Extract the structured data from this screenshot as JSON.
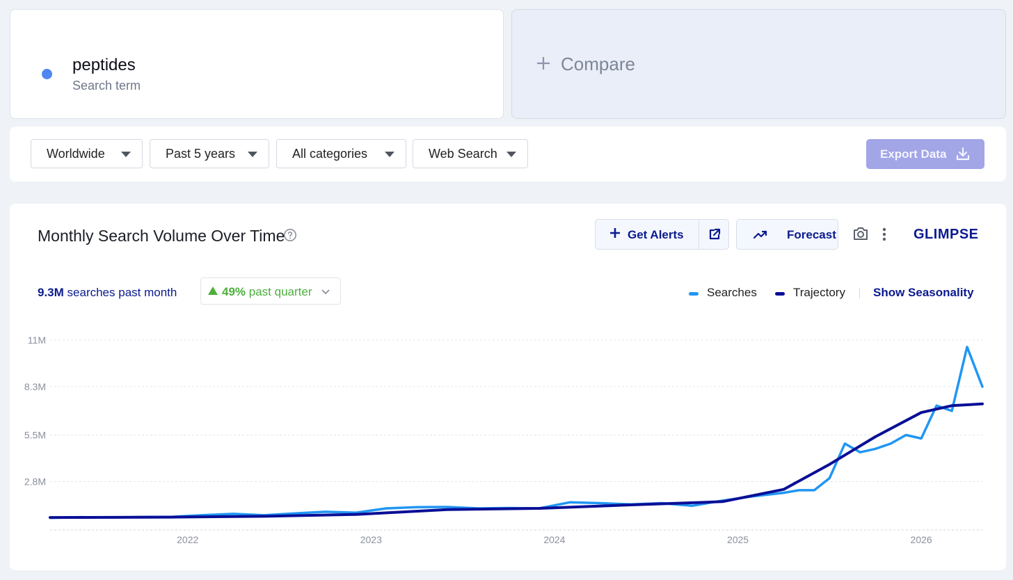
{
  "term": {
    "name": "peptides",
    "type": "Search term",
    "dot_color": "#4f87f0"
  },
  "compare": {
    "label": "Compare",
    "icon": "plus-icon"
  },
  "filters": {
    "location": "Worldwide",
    "period": "Past 5 years",
    "category": "All categories",
    "source": "Web Search"
  },
  "export": {
    "label": "Export Data",
    "icon": "download-icon"
  },
  "chart_header": {
    "title": "Monthly Search Volume Over Time",
    "help_icon": "help-circle-icon",
    "alerts_label": "Get Alerts",
    "forecast_label": "Forecast",
    "brand": "GLIMPSE",
    "camera_icon": "camera-icon",
    "more_icon": "more-vertical-icon"
  },
  "stats": {
    "value": "9.3M",
    "value_label": "searches past month",
    "change_pct": "49%",
    "change_label": "past quarter"
  },
  "legend": {
    "searches": "Searches",
    "trajectory": "Trajectory",
    "seasonality": "Show Seasonality"
  },
  "chart_data": {
    "type": "line",
    "x_ticks": [
      "2022",
      "2023",
      "2024",
      "2025",
      "2026"
    ],
    "y_ticks": [
      "11M",
      "8.3M",
      "5.5M",
      "2.8M"
    ],
    "y_tick_values": [
      11000000,
      8300000,
      5500000,
      2800000
    ],
    "ylim": [
      0,
      11000000
    ],
    "xlim": [
      "2021-04",
      "2026-05"
    ],
    "grid": true,
    "colors": {
      "searches": "#2196f3",
      "trajectory": "#0a0f96"
    },
    "series": [
      {
        "name": "Searches",
        "x": [
          "2021-04",
          "2021-06",
          "2021-08",
          "2021-10",
          "2021-12",
          "2022-02",
          "2022-04",
          "2022-06",
          "2022-08",
          "2022-10",
          "2022-12",
          "2023-02",
          "2023-04",
          "2023-06",
          "2023-08",
          "2023-10",
          "2023-12",
          "2024-02",
          "2024-04",
          "2024-06",
          "2024-08",
          "2024-10",
          "2024-12",
          "2025-02",
          "2025-04",
          "2025-05",
          "2025-06",
          "2025-07",
          "2025-08",
          "2025-09",
          "2025-10",
          "2025-11",
          "2025-12",
          "2026-01",
          "2026-02",
          "2026-03",
          "2026-04",
          "2026-05"
        ],
        "values": [
          700000,
          740000,
          720000,
          750000,
          760000,
          860000,
          930000,
          850000,
          960000,
          1050000,
          1000000,
          1250000,
          1320000,
          1330000,
          1250000,
          1270000,
          1250000,
          1600000,
          1550000,
          1480000,
          1550000,
          1400000,
          1700000,
          1950000,
          2150000,
          2300000,
          2300000,
          3000000,
          5000000,
          4500000,
          4700000,
          5000000,
          5500000,
          5300000,
          7200000,
          6900000,
          10600000,
          8300000
        ]
      },
      {
        "name": "Trajectory",
        "x": [
          "2021-04",
          "2021-12",
          "2022-06",
          "2022-12",
          "2023-06",
          "2023-12",
          "2024-06",
          "2024-12",
          "2025-04",
          "2025-07",
          "2025-10",
          "2026-01",
          "2026-03",
          "2026-05"
        ],
        "values": [
          720000,
          740000,
          790000,
          900000,
          1180000,
          1250000,
          1450000,
          1640000,
          2350000,
          3800000,
          5400000,
          6800000,
          7200000,
          7300000
        ]
      }
    ]
  }
}
